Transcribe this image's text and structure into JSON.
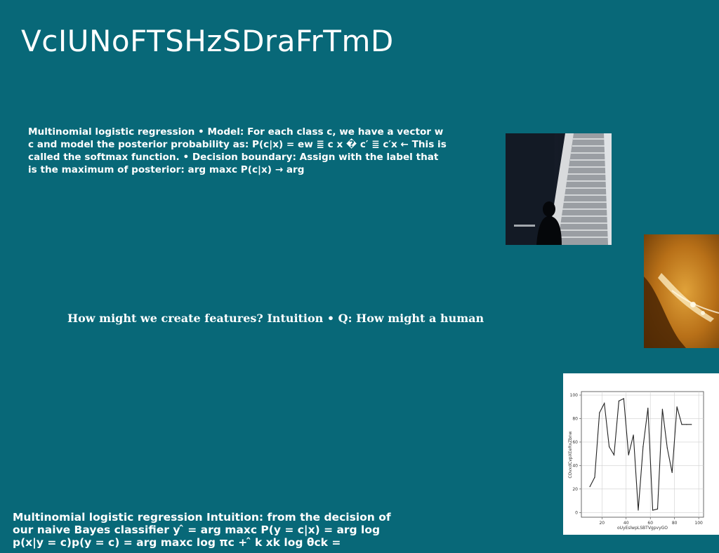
{
  "slide": {
    "title": "VcIUNoFTSHzSDraFrTmD",
    "text_block_1": "Multinomial logistic regression • Model: For each class c, we have a vector w c and model the posterior probability as: P(c|x) = ew ≣ c x � c′ ≣ c′x ← This is called the softmax function. • Decision boundary: Assign with the label that is the maximum of posterior: arg maxc P(c|x) → arg",
    "text_block_2": "How might we create features? Intuition • Q: How might a human",
    "text_block_3": "Multinomial logistic regression Intuition: from the decision of our naive Bayes classifier y ̂ = arg maxc P(y = c|x) = arg log p(x|y = c)p(y = c) = arg maxc log πc + ̂ k xk log θck ="
  },
  "chart_data": {
    "type": "line",
    "xlabel": "oUyEslwpLSBTVgpvyGO",
    "ylabel": "COvxdCvpXEeRxZbnw",
    "xlim": [
      3,
      104
    ],
    "ylim": [
      -4,
      103
    ],
    "xticks": [
      20,
      40,
      60,
      80,
      100
    ],
    "yticks": [
      0,
      20,
      40,
      60,
      80,
      100
    ],
    "grid": true,
    "x": [
      10,
      14,
      18,
      22,
      26,
      30,
      34,
      38,
      42,
      46,
      50,
      54,
      58,
      62,
      66,
      70,
      74,
      78,
      82,
      86,
      90,
      94
    ],
    "y": [
      22,
      30,
      85,
      93,
      56,
      49,
      95,
      97,
      49,
      66,
      2,
      56,
      89,
      2,
      3,
      88,
      55,
      34,
      90,
      75,
      75,
      75
    ],
    "line_color": "#222222"
  }
}
